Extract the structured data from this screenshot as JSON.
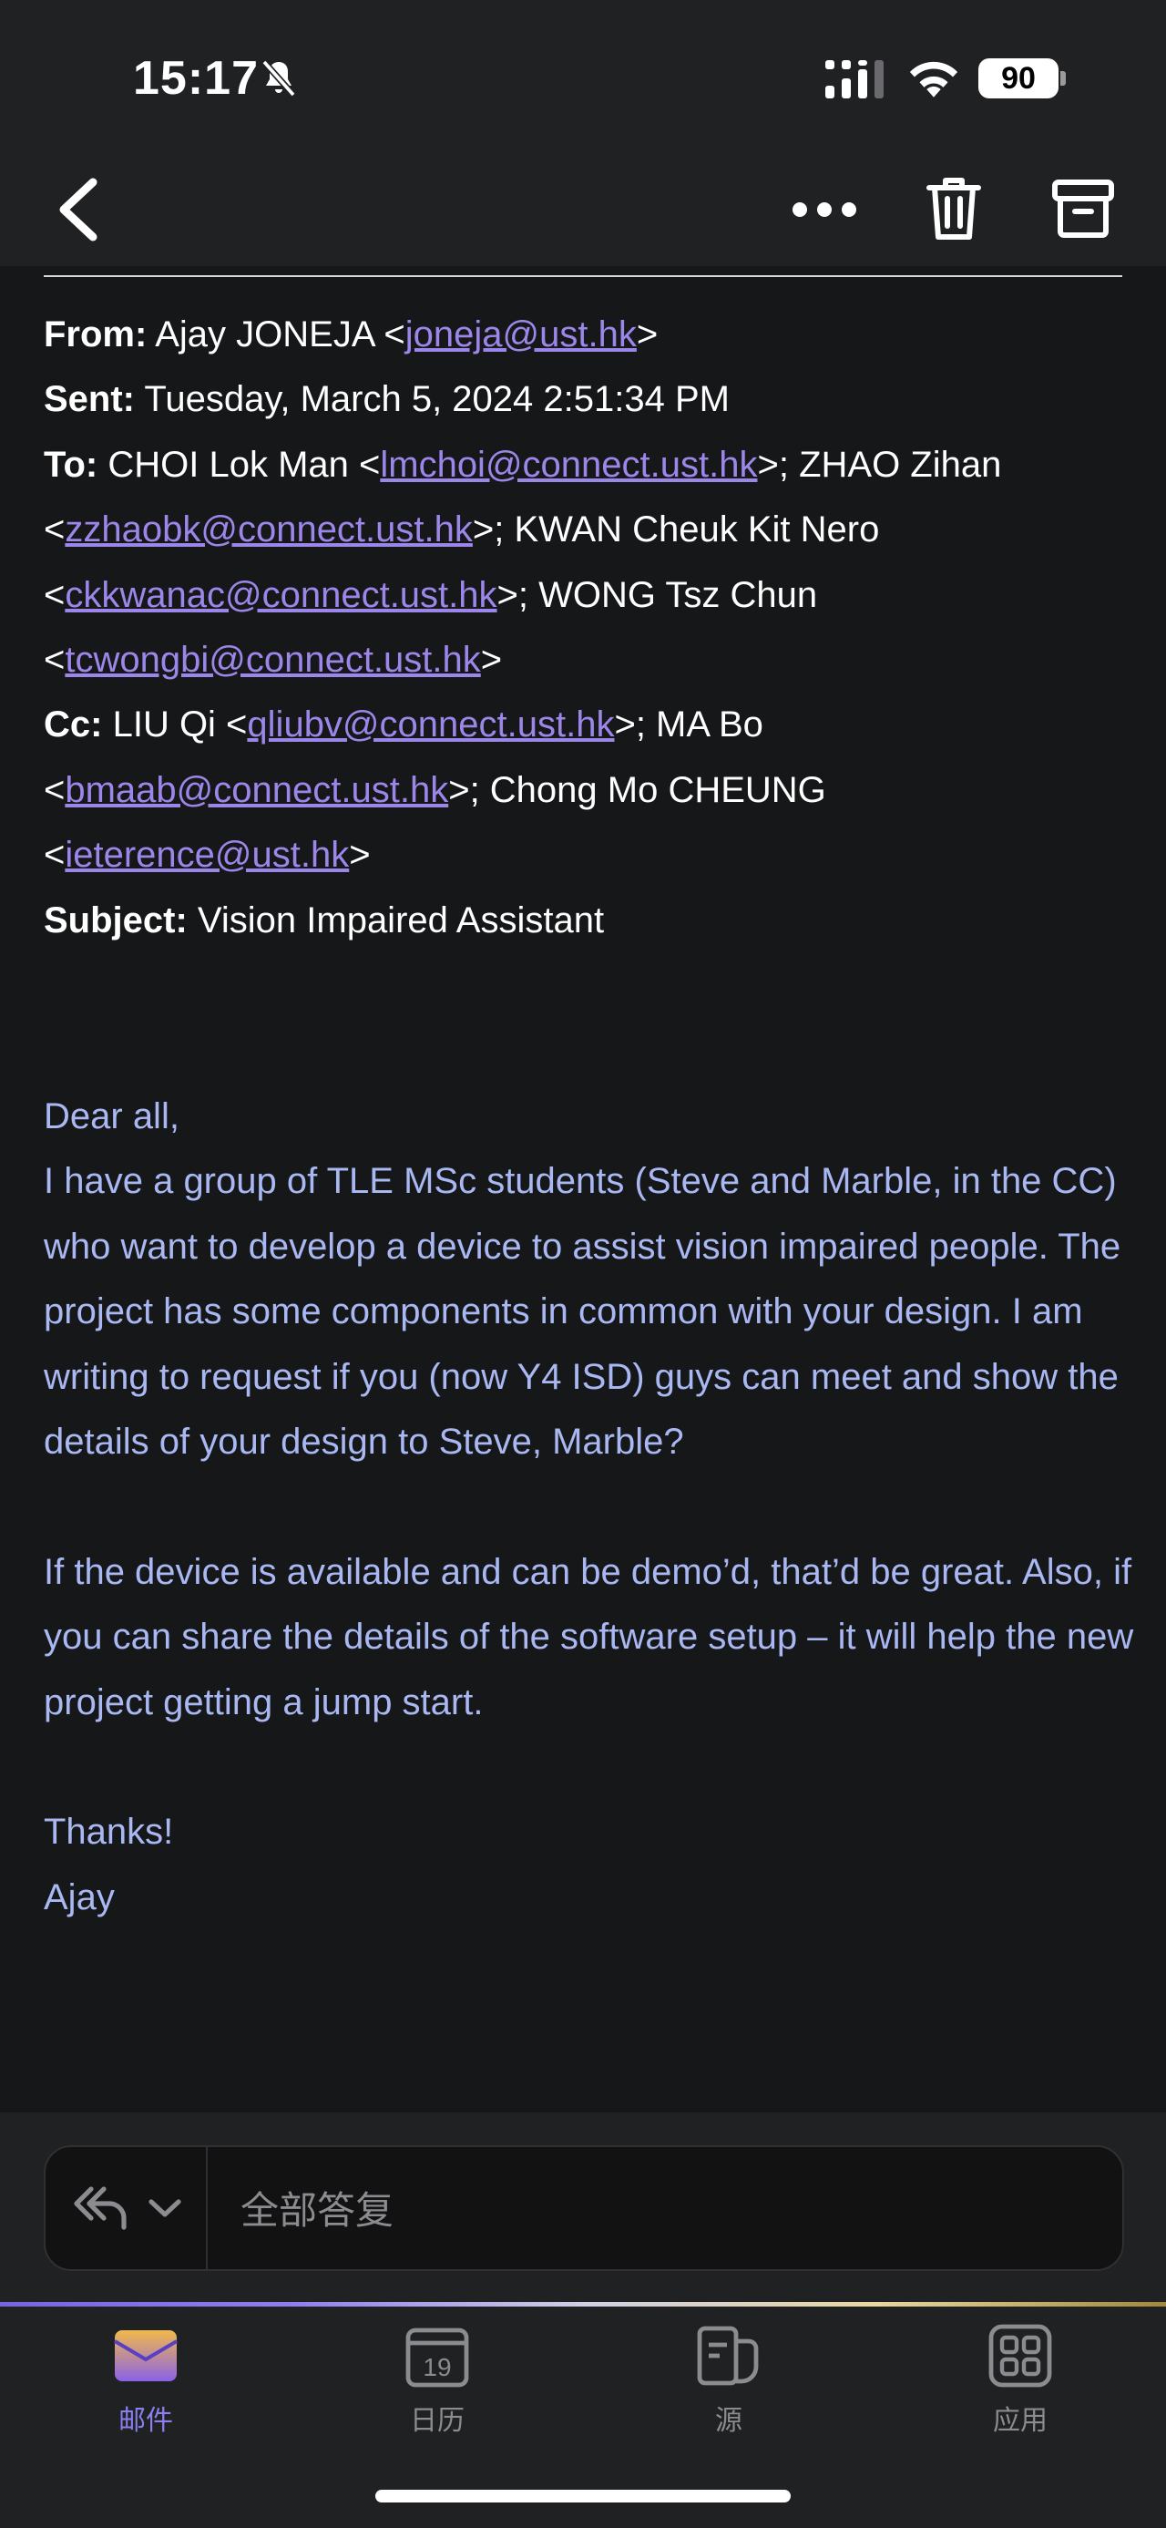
{
  "status_bar": {
    "time": "15:17",
    "battery": "90",
    "icons": [
      "bell-off-icon",
      "signal-icon",
      "wifi-icon",
      "battery-icon"
    ]
  },
  "nav": {
    "icons": [
      "chevron-left-icon",
      "more-icon",
      "trash-icon",
      "archive-icon"
    ]
  },
  "email": {
    "from_label": "From:",
    "from_name": "Ajay JONEJA <",
    "from_email": "joneja@ust.hk",
    "from_close": ">",
    "sent_label": "Sent:",
    "sent_value": "Tuesday, March 5, 2024 2:51:34 PM",
    "to_label": "To:",
    "to_1_name": "CHOI Lok Man <",
    "to_1_email": "lmchoi@connect.ust.hk",
    "to_1_close": ">; ZHAO Zihan",
    "to_2_open": "<",
    "to_2_email": "zzhaobk@connect.ust.hk",
    "to_2_close": ">; KWAN Cheuk Kit Nero",
    "to_3_open": "<",
    "to_3_email": "ckkwanac@connect.ust.hk",
    "to_3_close": ">; WONG Tsz Chun",
    "to_4_open": "<",
    "to_4_email": "tcwongbi@connect.ust.hk",
    "to_4_close": ">",
    "cc_label": "Cc:",
    "cc_1_name": "LIU Qi <",
    "cc_1_email": "qliubv@connect.ust.hk",
    "cc_1_close": ">; MA Bo",
    "cc_2_open": "<",
    "cc_2_email": "bmaab@connect.ust.hk",
    "cc_2_close": ">; Chong Mo CHEUNG",
    "cc_3_open": "<",
    "cc_3_email": "ieterence@ust.hk",
    "cc_3_close": ">",
    "subject_label": "Subject:",
    "subject_value": "Vision Impaired Assistant",
    "greeting": "Dear all,",
    "paragraph_1": "I have a group of TLE MSc students (Steve and Marble, in the CC) who want to develop a device to assist vision impaired people. The project has some components in common with your design. I am writing to request if you (now Y4 ISD) guys can meet and show the details of your design to Steve, Marble?",
    "paragraph_2": "If the device is available and can be demo’d, that’d be great. Also, if you can share the details of the software setup – it will help the new project getting a jump start.",
    "thanks": "Thanks!",
    "signature": "Ajay"
  },
  "reply": {
    "placeholder": "全部答复",
    "icons": [
      "reply-all-icon",
      "chevron-down-icon"
    ]
  },
  "tabs": [
    {
      "label": "邮件",
      "icon": "mail-icon",
      "active": true
    },
    {
      "label": "日历",
      "icon": "calendar-icon",
      "day": "19"
    },
    {
      "label": "源",
      "icon": "feed-icon"
    },
    {
      "label": "应用",
      "icon": "apps-icon"
    }
  ],
  "colors": {
    "background": "#161718",
    "bar": "#202123",
    "link": "#9d86ea",
    "body_text": "#a9b8f3",
    "accent": "#8b7ff0"
  }
}
